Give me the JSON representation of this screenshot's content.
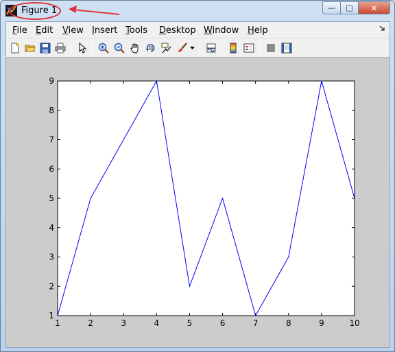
{
  "window": {
    "title": "Figure 1",
    "controls": {
      "minimize": "—",
      "maximize": "□",
      "close": "✕"
    }
  },
  "menu": {
    "items": [
      {
        "label": "File",
        "mnemonic": "F"
      },
      {
        "label": "Edit",
        "mnemonic": "E"
      },
      {
        "label": "View",
        "mnemonic": "V"
      },
      {
        "label": "Insert",
        "mnemonic": "I"
      },
      {
        "label": "Tools",
        "mnemonic": "T"
      },
      {
        "label": "Desktop",
        "mnemonic": "D"
      },
      {
        "label": "Window",
        "mnemonic": "W"
      },
      {
        "label": "Help",
        "mnemonic": "H"
      }
    ]
  },
  "toolbar": {
    "buttons": [
      "new-figure-icon",
      "open-file-icon",
      "save-figure-icon",
      "print-figure-icon",
      "edit-plot-arrow-icon",
      "zoom-in-icon",
      "zoom-out-icon",
      "pan-hand-icon",
      "rotate-3d-icon",
      "data-cursor-icon",
      "brush-icon",
      "brush-dropdown-icon",
      "link-plot-icon",
      "insert-colorbar-icon",
      "insert-legend-icon",
      "hide-plot-tools-icon",
      "show-plot-tools-icon"
    ]
  },
  "annotation": {
    "color": "#e0333a"
  },
  "chart_data": {
    "type": "line",
    "x": [
      1,
      2,
      3,
      4,
      5,
      6,
      7,
      8,
      9,
      10
    ],
    "series": [
      {
        "values": [
          1,
          5,
          7,
          9,
          2,
          5,
          1,
          3,
          9,
          5
        ],
        "color": "#0000ff"
      }
    ],
    "xlim": [
      1,
      10
    ],
    "ylim": [
      1,
      9
    ],
    "xticks": [
      1,
      2,
      3,
      4,
      5,
      6,
      7,
      8,
      9,
      10
    ],
    "yticks": [
      1,
      2,
      3,
      4,
      5,
      6,
      7,
      8,
      9
    ],
    "grid": false,
    "title": "",
    "xlabel": "",
    "ylabel": ""
  }
}
